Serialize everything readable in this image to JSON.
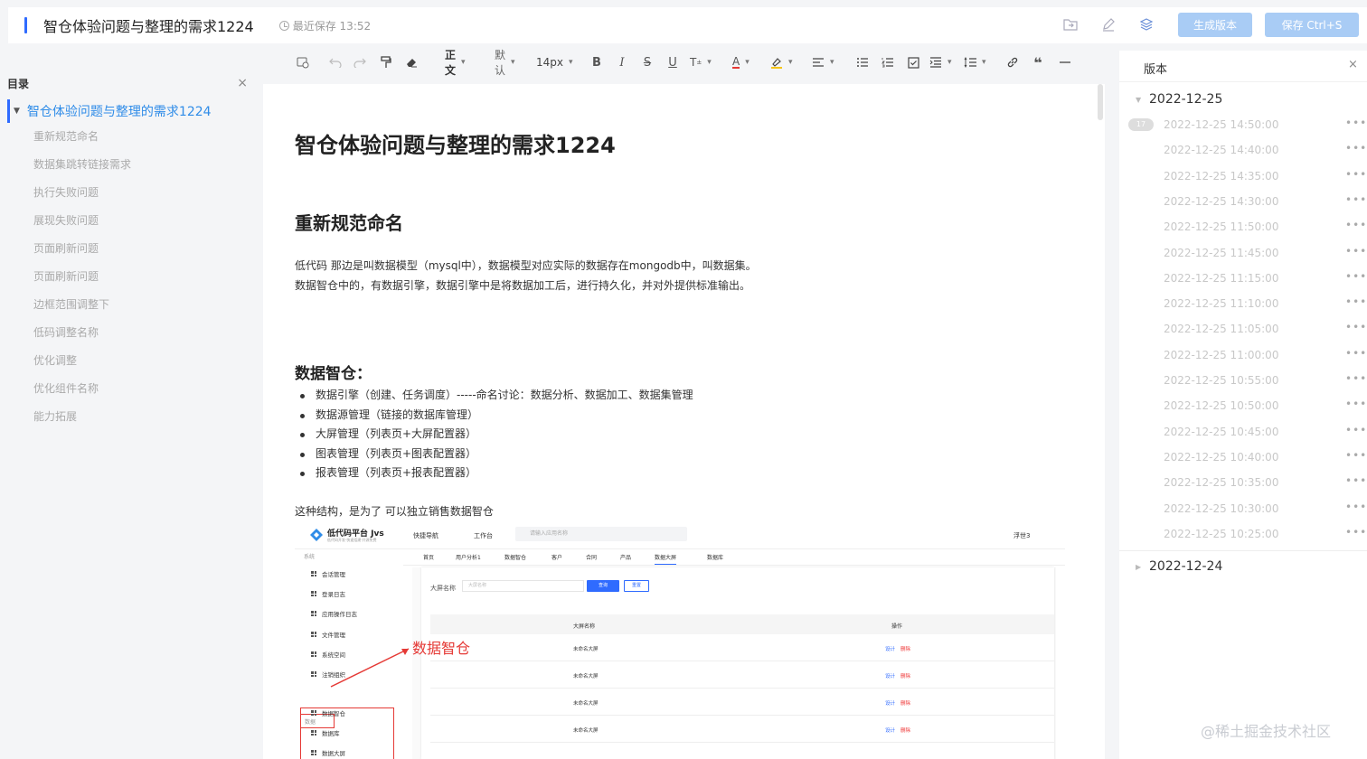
{
  "header": {
    "title": "智仓体验问题与整理的需求1224",
    "saved": "最近保存 13:52",
    "generate_label": "生成版本",
    "save_label": "保存 Ctrl+S"
  },
  "toolbar": {
    "paragraph_style": "正文",
    "font_family": "默认",
    "font_size": "14px",
    "text_color": "#e53935",
    "highlight_color": "#f5c518"
  },
  "outline": {
    "title": "目录",
    "root": "智仓体验问题与整理的需求1224",
    "items": [
      "重新规范命名",
      "数据集跳转链接需求",
      "执行失败问题",
      "展现失败问题",
      "页面刷新问题",
      "页面刷新问题",
      "边框范围调整下",
      "低码调整名称",
      "优化调整",
      "优化组件名称",
      "能力拓展"
    ]
  },
  "doc": {
    "title": "智仓体验问题与整理的需求1224",
    "h2a": "重新规范命名",
    "para_line1": "低代码 那边是叫数据模型（mysql中），数据模型对应实际的数据存在mongodb中，叫数据集。",
    "para_line2": "数据智仓中的，有数据引擎，数据引擎中是将数据加工后，进行持久化，并对外提供标准输出。",
    "h2b": "数据智仓：",
    "bullets": [
      "数据引擎（创建、任务调度）-----命名讨论：数据分析、数据加工、数据集管理",
      "数据源管理（链接的数据库管理）",
      "大屏管理（列表页+大屏配置器）",
      "图表管理（列表页+图表配置器）",
      "报表管理（列表页+报表配置器）"
    ],
    "para2": "这种结构，是为了 可以独立销售数据智仓"
  },
  "shot": {
    "brand": "低代码平台 Jvs",
    "brand_sub": "低代码开发·快速搭建·开源免费",
    "nav1": "快捷导航",
    "nav2": "工作台",
    "search_placeholder": "请输入应用名称",
    "user": "浮世3",
    "group_system": "系统",
    "side_items": [
      "会话管理",
      "登录日志",
      "应用操作日志",
      "文件管理",
      "系统空间",
      "注销组织"
    ],
    "group_data": "数据",
    "data_items": [
      "数据智仓",
      "数据库",
      "数据大屏"
    ],
    "tabs": [
      "首页",
      "用户分析1",
      "数据智仓",
      "客户",
      "合同",
      "产品",
      "数据大屏",
      "数据库"
    ],
    "filter_label": "大屏名称",
    "filter_placeholder": "大屏名称",
    "query_label": "查询",
    "reset_label": "重置",
    "col_name": "大屏名称",
    "col_action": "操作",
    "rows": [
      "未命名大屏",
      "未命名大屏",
      "未命名大屏",
      "未命名大屏"
    ],
    "design_label": "设计",
    "delete_label": "删除",
    "annotation": "数据智仓"
  },
  "versions": {
    "title": "版本",
    "badge": "17",
    "group1": "2022-12-25",
    "items": [
      "2022-12-25 14:50:00",
      "2022-12-25 14:40:00",
      "2022-12-25 14:35:00",
      "2022-12-25 14:30:00",
      "2022-12-25 11:50:00",
      "2022-12-25 11:45:00",
      "2022-12-25 11:15:00",
      "2022-12-25 11:10:00",
      "2022-12-25 11:05:00",
      "2022-12-25 11:00:00",
      "2022-12-25 10:55:00",
      "2022-12-25 10:50:00",
      "2022-12-25 10:45:00",
      "2022-12-25 10:40:00",
      "2022-12-25 10:35:00",
      "2022-12-25 10:30:00",
      "2022-12-25 10:25:00"
    ],
    "group2": "2022-12-24"
  },
  "watermark": "@稀土掘金技术社区"
}
